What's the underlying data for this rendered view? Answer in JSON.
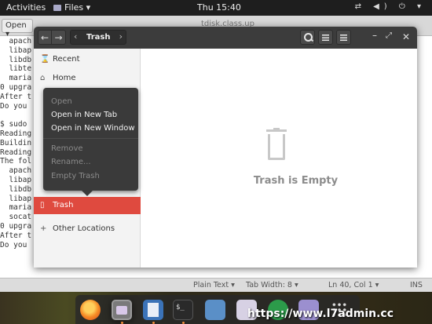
{
  "topbar": {
    "activities": "Activities",
    "app_menu": "Files ▾",
    "clock": "Thu 15:40",
    "tray": "⇄ ◀) ⏻ ▾"
  },
  "gedit": {
    "open_label": "Open ▾",
    "title": "tdisk.class.up",
    "terminal_lines": [
      "  apach",
      "  libap",
      "  libdb",
      "  libte",
      "  maria",
      "0 upgra",
      "After t",
      "Do you ",
      "",
      "$ sudo ",
      "Reading",
      "Buildin",
      "Reading",
      "The fol",
      "  apach",
      "  libap",
      "  libdb",
      "  libap",
      "  maria",
      "  socat",
      "0 upgra",
      "After t",
      "Do you "
    ],
    "status": {
      "language": "Plain Text ▾",
      "tab_width": "Tab Width: 8 ▾",
      "position": "Ln 40, Col 1 ▾",
      "mode": "INS"
    }
  },
  "files_window": {
    "path_crumb": "Trash",
    "sidebar": {
      "recent": "Recent",
      "home": "Home",
      "trash": "Trash",
      "other_locations": "Other Locations"
    },
    "empty_message": "Trash is Empty"
  },
  "context_menu": {
    "open": "Open",
    "open_new_tab": "Open in New Tab",
    "open_new_window": "Open in New Window",
    "remove": "Remove",
    "rename": "Rename...",
    "empty_trash": "Empty Trash"
  },
  "watermark": "https://www.l7admin.cc"
}
